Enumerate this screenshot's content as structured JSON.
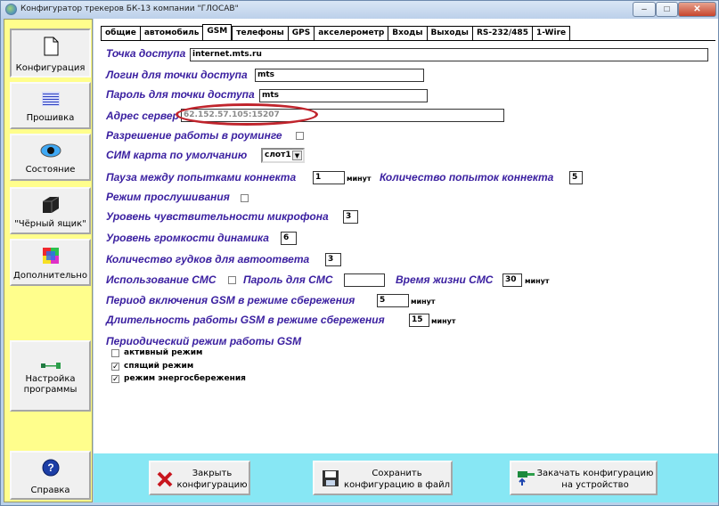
{
  "window": {
    "title": "Конфигуратор трекеров БК-13 компании \"ГЛОСАВ\"",
    "minimize": "–",
    "maximize": "□",
    "close": "✕"
  },
  "sidebar": {
    "items": [
      {
        "label": "Конфигурация",
        "icon": "document-icon"
      },
      {
        "label": "Прошивка",
        "icon": "binary-icon"
      },
      {
        "label": "Состояние",
        "icon": "eye-icon"
      },
      {
        "label": "\"Чёрный ящик\"",
        "icon": "black-box-icon"
      },
      {
        "label": "Дополнительно",
        "icon": "color-grid-icon"
      },
      {
        "label": "Настройка программы",
        "icon": "connector-icon"
      },
      {
        "label": "Справка",
        "icon": "help-icon"
      }
    ]
  },
  "tabs": [
    "общие",
    "автомобиль",
    "GSM",
    "телефоны",
    "GPS",
    "акселерометр",
    "Входы",
    "Выходы",
    "RS-232/485",
    "1-Wire"
  ],
  "active_tab": "GSM",
  "form": {
    "ap_label": "Точка доступа",
    "ap_value": "internet.mts.ru",
    "login_label": "Логин для точки доступа",
    "login_value": "mts",
    "pass_label": "Пароль для точки доступа",
    "pass_value": "mts",
    "server_label": "Адрес сервер",
    "server_value": "62.152.57.105:15207",
    "roaming_label": "Разрешение работы в роуминге",
    "sim_label": "СИМ карта по умолчанию",
    "sim_value": "слот1",
    "pause_label": "Пауза между попытками коннекта",
    "pause_value": "1",
    "pause_unit": "минут",
    "attempts_label": "Количество попыток коннекта",
    "attempts_value": "5",
    "listen_label": "Режим прослушивания",
    "mic_label": "Уровень чувствительности микрофона",
    "mic_value": "3",
    "spk_label": "Уровень громкости динамика",
    "spk_value": "6",
    "rings_label": "Количество гудков для автоответа",
    "rings_value": "3",
    "sms_label": "Использование СМС",
    "sms_pass_label": "Пароль для СМС",
    "sms_pass_value": "",
    "sms_life_label": "Время жизни СМС",
    "sms_life_value": "30",
    "sms_life_unit": "минут",
    "gsm_on_label": "Период включения GSM в режиме сбережения",
    "gsm_on_value": "5",
    "gsm_on_unit": "минут",
    "gsm_dur_label": "Длительность работы GSM в режиме сбережения",
    "gsm_dur_value": "15",
    "gsm_dur_unit": "минут",
    "periodic_label": "Периодический режим работы GSM",
    "modes": [
      {
        "label": "активный режим",
        "checked": false
      },
      {
        "label": "спящий режим",
        "checked": true
      },
      {
        "label": "режим энергосбережения",
        "checked": true
      }
    ]
  },
  "bottom": {
    "close_line1": "Закрыть",
    "close_line2": "конфигурацию",
    "save_line1": "Сохранить",
    "save_line2": "конфигурацию в файл",
    "upload_line1": "Закачать конфигурацию",
    "upload_line2": "на устройство"
  }
}
